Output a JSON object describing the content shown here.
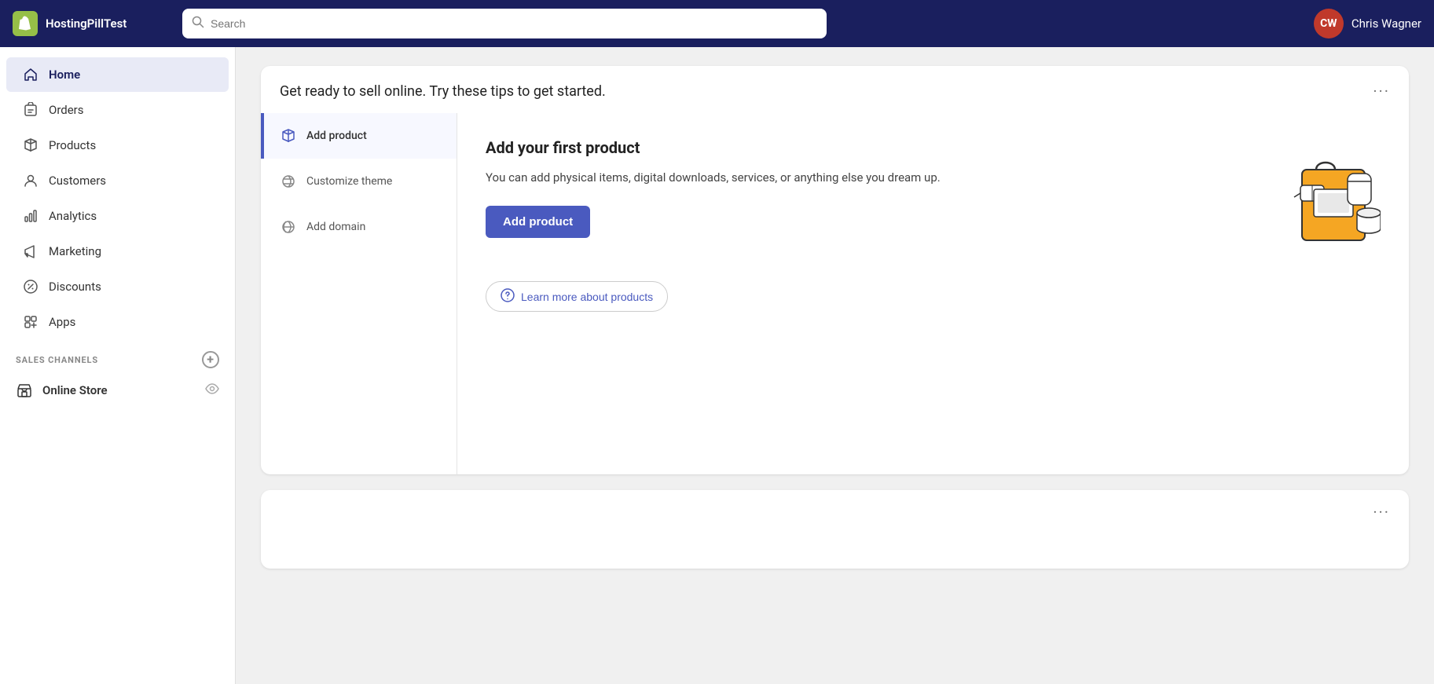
{
  "topbar": {
    "brand_name": "HostingPillTest",
    "search_placeholder": "Search",
    "user_initials": "CW",
    "user_name": "Chris Wagner"
  },
  "sidebar": {
    "nav_items": [
      {
        "id": "home",
        "label": "Home",
        "icon": "home",
        "active": true
      },
      {
        "id": "orders",
        "label": "Orders",
        "icon": "orders",
        "active": false
      },
      {
        "id": "products",
        "label": "Products",
        "icon": "products",
        "active": false
      },
      {
        "id": "customers",
        "label": "Customers",
        "icon": "customers",
        "active": false
      },
      {
        "id": "analytics",
        "label": "Analytics",
        "icon": "analytics",
        "active": false
      },
      {
        "id": "marketing",
        "label": "Marketing",
        "icon": "marketing",
        "active": false
      },
      {
        "id": "discounts",
        "label": "Discounts",
        "icon": "discounts",
        "active": false
      },
      {
        "id": "apps",
        "label": "Apps",
        "icon": "apps",
        "active": false
      }
    ],
    "sales_channels_label": "SALES CHANNELS",
    "channels": [
      {
        "id": "online-store",
        "label": "Online Store"
      }
    ]
  },
  "main": {
    "card1": {
      "title": "Get ready to sell online. Try these tips to get started.",
      "dots_label": "···",
      "steps": [
        {
          "id": "add-product",
          "label": "Add product",
          "active": true
        },
        {
          "id": "customize-theme",
          "label": "Customize theme",
          "active": false
        },
        {
          "id": "add-domain",
          "label": "Add domain",
          "active": false
        }
      ],
      "active_step": {
        "heading": "Add your first product",
        "body": "You can add physical items, digital downloads, services, or anything else you dream up.",
        "cta_label": "Add product",
        "learn_more_label": "Learn more about products"
      }
    },
    "card2": {
      "dots_label": "···"
    }
  }
}
